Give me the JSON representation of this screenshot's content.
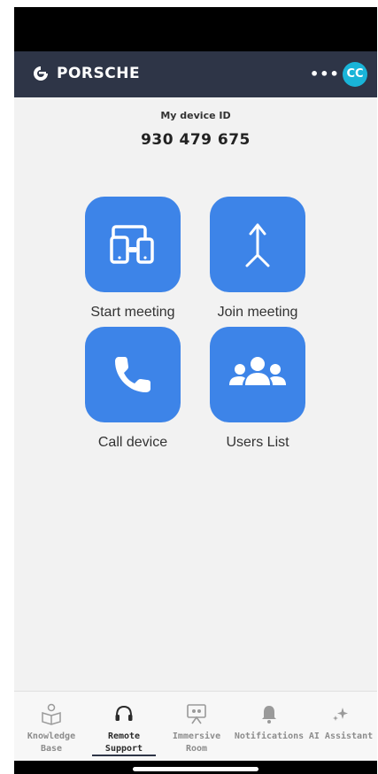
{
  "header": {
    "logo_text": "PORSCHE",
    "more_label": "•••",
    "avatar_initials": "CC"
  },
  "device": {
    "label": "My device ID",
    "value": "930 479 675"
  },
  "actions": [
    {
      "label": "Start meeting",
      "icon": "devices-icon"
    },
    {
      "label": "Join meeting",
      "icon": "merge-arrow-icon"
    },
    {
      "label": "Call device",
      "icon": "phone-icon"
    },
    {
      "label": "Users List",
      "icon": "users-group-icon"
    }
  ],
  "tabs": [
    {
      "line1": "Knowledge",
      "line2": "Base",
      "icon": "book-person-icon",
      "active": false
    },
    {
      "line1": "Remote",
      "line2": "Support",
      "icon": "headset-icon",
      "active": true
    },
    {
      "line1": "Immersive",
      "line2": "Room",
      "icon": "presentation-icon",
      "active": false
    },
    {
      "line1": "Notifications",
      "line2": "",
      "icon": "bell-icon",
      "active": false
    },
    {
      "line1": "AI Assistant",
      "line2": "",
      "icon": "sparkle-icon",
      "active": false
    }
  ],
  "colors": {
    "header_bg": "#2e3547",
    "tile_blue": "#3d84e8",
    "avatar_bg": "#19b4d8"
  }
}
